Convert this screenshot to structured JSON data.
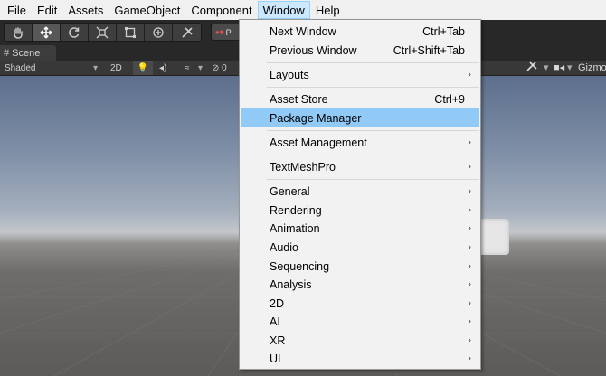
{
  "menubar": {
    "items": [
      {
        "label": "File",
        "active": false
      },
      {
        "label": "Edit",
        "active": false
      },
      {
        "label": "Assets",
        "active": false
      },
      {
        "label": "GameObject",
        "active": false
      },
      {
        "label": "Component",
        "active": false
      },
      {
        "label": "Window",
        "active": true
      },
      {
        "label": "Help",
        "active": false
      }
    ]
  },
  "toolbar": {
    "tools": [
      "hand-tool",
      "move-tool",
      "rotate-tool",
      "scale-tool",
      "rect-tool",
      "transform-tool",
      "custom-tool"
    ],
    "pivot_label": "P"
  },
  "scene_tab": {
    "label": "Scene"
  },
  "scene_toolbar": {
    "shading_mode": "Shaded",
    "mode_2d": "2D",
    "hidden_count": "0",
    "gizmos_label": "Gizmo"
  },
  "window_menu": {
    "items": [
      {
        "label": "Next Window",
        "shortcut": "Ctrl+Tab",
        "submenu": false
      },
      {
        "label": "Previous Window",
        "shortcut": "Ctrl+Shift+Tab",
        "submenu": false
      },
      {
        "label": "Layouts",
        "shortcut": "",
        "submenu": true
      },
      {
        "label": "Asset Store",
        "shortcut": "Ctrl+9",
        "submenu": false
      },
      {
        "label": "Package Manager",
        "shortcut": "",
        "submenu": false,
        "highlighted": true
      },
      {
        "label": "Asset Management",
        "shortcut": "",
        "submenu": true
      },
      {
        "label": "TextMeshPro",
        "shortcut": "",
        "submenu": true
      },
      {
        "label": "General",
        "shortcut": "",
        "submenu": true
      },
      {
        "label": "Rendering",
        "shortcut": "",
        "submenu": true
      },
      {
        "label": "Animation",
        "shortcut": "",
        "submenu": true
      },
      {
        "label": "Audio",
        "shortcut": "",
        "submenu": true
      },
      {
        "label": "Sequencing",
        "shortcut": "",
        "submenu": true
      },
      {
        "label": "Analysis",
        "shortcut": "",
        "submenu": true
      },
      {
        "label": "2D",
        "shortcut": "",
        "submenu": true
      },
      {
        "label": "AI",
        "shortcut": "",
        "submenu": true
      },
      {
        "label": "XR",
        "shortcut": "",
        "submenu": true
      },
      {
        "label": "UI",
        "shortcut": "",
        "submenu": true
      }
    ]
  },
  "colors": {
    "menu_highlight": "#91c9f7",
    "menubar_active": "#cce8ff",
    "editor_dark": "#282828"
  }
}
